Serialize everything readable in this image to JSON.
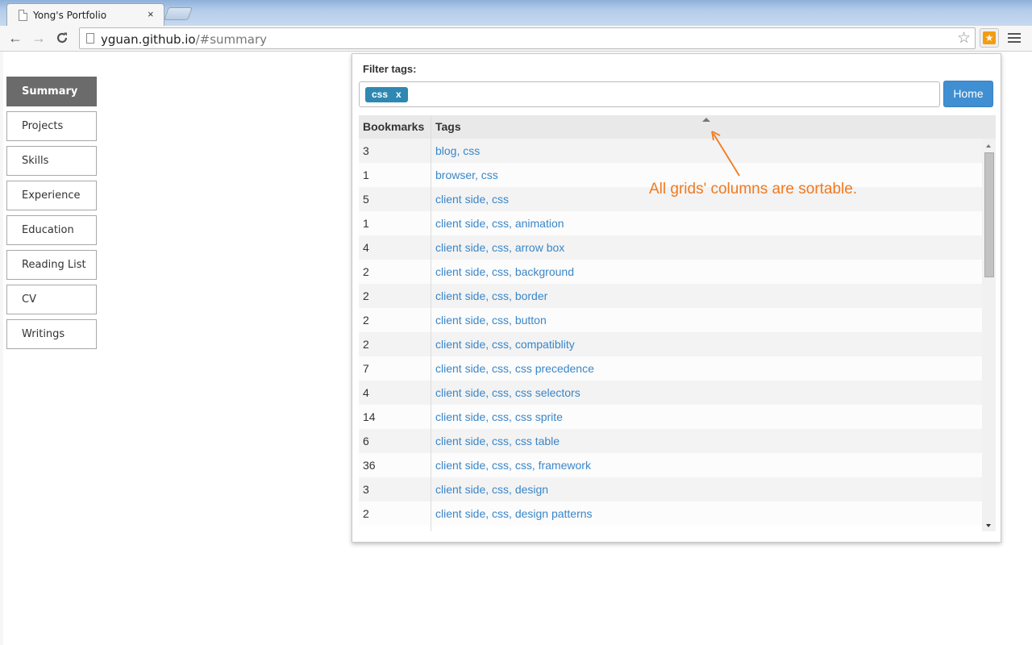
{
  "browser": {
    "tab_title": "Yong's Portfolio",
    "tab_close": "×",
    "url_host": "yguan.github.io",
    "url_path": "/#summary",
    "back_glyph": "←",
    "forward_glyph": "→",
    "reload_glyph": "C",
    "star_glyph": "☆",
    "ext_glyph": "★"
  },
  "sidebar": {
    "items": [
      {
        "label": "Summary",
        "active": true
      },
      {
        "label": "Projects"
      },
      {
        "label": "Skills"
      },
      {
        "label": "Experience"
      },
      {
        "label": "Education"
      },
      {
        "label": "Reading List"
      },
      {
        "label": "CV"
      },
      {
        "label": "Writings"
      }
    ]
  },
  "panel": {
    "filter_label": "Filter tags:",
    "chip_label": "css",
    "chip_remove": "x",
    "home_label": "Home",
    "columns": [
      "Bookmarks",
      "Tags"
    ],
    "sorted_column": "Tags",
    "sort_direction": "ascending",
    "rows": [
      {
        "count": "3",
        "tags": "blog, css"
      },
      {
        "count": "1",
        "tags": "browser, css"
      },
      {
        "count": "5",
        "tags": "client side, css"
      },
      {
        "count": "1",
        "tags": "client side, css, animation"
      },
      {
        "count": "4",
        "tags": "client side, css, arrow box"
      },
      {
        "count": "2",
        "tags": "client side, css, background"
      },
      {
        "count": "2",
        "tags": "client side, css, border"
      },
      {
        "count": "2",
        "tags": "client side, css, button"
      },
      {
        "count": "2",
        "tags": "client side, css, compatiblity"
      },
      {
        "count": "7",
        "tags": "client side, css, css precedence"
      },
      {
        "count": "4",
        "tags": "client side, css, css selectors"
      },
      {
        "count": "14",
        "tags": "client side, css, css sprite"
      },
      {
        "count": "6",
        "tags": "client side, css, css table"
      },
      {
        "count": "36",
        "tags": "client side, css, css, framework"
      },
      {
        "count": "3",
        "tags": "client side, css, design"
      },
      {
        "count": "2",
        "tags": "client side, css, design patterns"
      }
    ],
    "annotation": "All grids' columns are sortable."
  },
  "colors": {
    "accent": "#3f8fd2",
    "chip": "#2e88b2",
    "link": "#3a86c8",
    "annotation": "#f07a20",
    "active_nav": "#6b6b6b"
  }
}
